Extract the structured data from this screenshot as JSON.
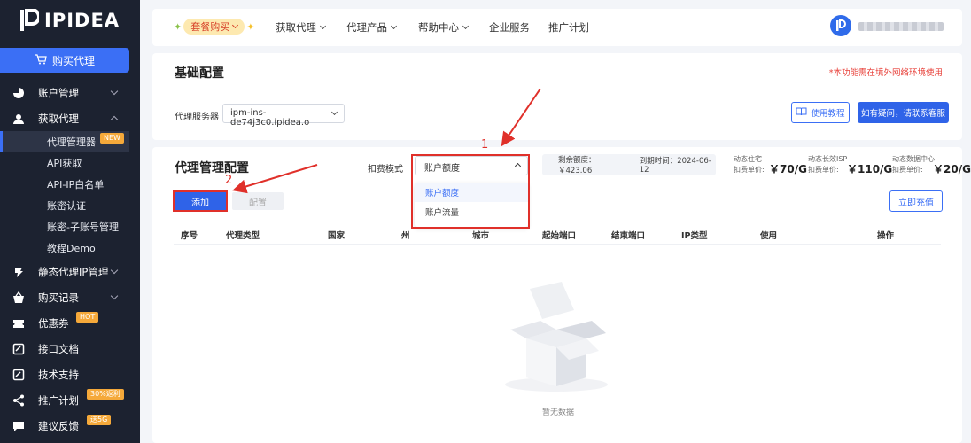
{
  "brand": {
    "name": "IPIDEA"
  },
  "sidebar": {
    "buy_button": "购买代理",
    "menu": [
      {
        "label": "账户管理",
        "icon": "pie-chart-icon"
      },
      {
        "label": "获取代理",
        "icon": "user-icon"
      }
    ],
    "submenu": [
      {
        "label": "代理管理器",
        "tag": "NEW",
        "active": true
      },
      {
        "label": "API获取"
      },
      {
        "label": "API-IP白名单"
      },
      {
        "label": "账密认证"
      },
      {
        "label": "账密-子账号管理"
      },
      {
        "label": "教程Demo"
      }
    ],
    "menu2": [
      {
        "label": "静态代理IP管理",
        "icon": "static-ip-icon"
      },
      {
        "label": "购买记录",
        "icon": "basket-icon"
      },
      {
        "label": "优惠券",
        "icon": "coupon-icon",
        "tag": "HOT"
      },
      {
        "label": "接口文档",
        "icon": "doc-icon"
      },
      {
        "label": "技术支持",
        "icon": "support-icon"
      },
      {
        "label": "推广计划",
        "icon": "share-icon",
        "tag": "30%返利"
      },
      {
        "label": "建议反馈",
        "icon": "feedback-icon",
        "tag": "送5G"
      }
    ]
  },
  "topnav": {
    "promo": "套餐购买",
    "items": [
      "获取代理",
      "代理产品",
      "帮助中心",
      "企业服务",
      "推广计划"
    ]
  },
  "basic_config": {
    "title": "基础配置",
    "note": "*本功能需在境外网络环境使用",
    "server_label": "代理服务器",
    "server_value": "ipm-ins-de74j3c0.ipidea.o",
    "tutorial_button": "使用教程",
    "contact_button": "如有疑问，请联系客服"
  },
  "proxy_config": {
    "title": "代理管理配置",
    "mode_label": "扣费模式",
    "mode_value": "账户额度",
    "mode_options": [
      "账户额度",
      "账户流量"
    ],
    "balance": "剩余额度：￥423.06",
    "expiry": "到期时间：2024-06-12",
    "prices": [
      {
        "line1": "动态住宅",
        "line2": "扣费单价:",
        "amount": "￥70/G"
      },
      {
        "line1": "动态长效ISP",
        "line2": "扣费单价:",
        "amount": "￥110/G"
      },
      {
        "line1": "动态数据中心",
        "line2": "扣费单价:",
        "amount": "￥20/G"
      }
    ],
    "add_button": "添加",
    "config_button": "配置",
    "recharge_button": "立即充值",
    "columns": [
      "序号",
      "代理类型",
      "国家",
      "州",
      "城市",
      "起始端口",
      "结束端口",
      "IP类型",
      "使用",
      "操作"
    ],
    "empty_text": "暂无数据"
  },
  "annotations": {
    "step1": "1",
    "step2": "2"
  },
  "colors": {
    "sidebar_bg": "#1c2230",
    "accent": "#3b6ff5",
    "annotation": "#e0302a"
  }
}
